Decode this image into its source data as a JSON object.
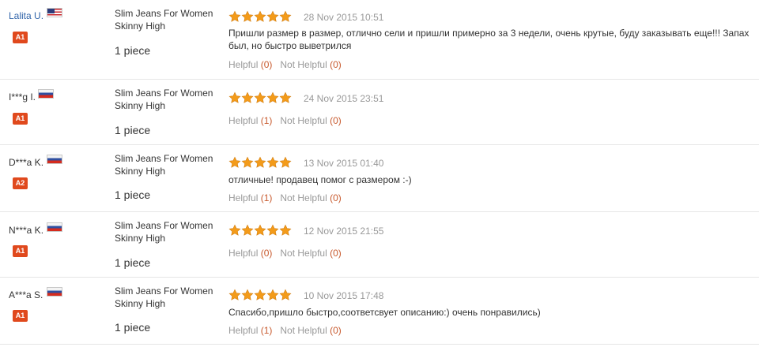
{
  "colors": {
    "level_badge": "#e0491d",
    "star": "#f39b1a",
    "count": "#c85a2e",
    "muted": "#999999",
    "link": "#3366aa"
  },
  "labels": {
    "helpful": "Helpful",
    "not_helpful": "Not Helpful"
  },
  "reviews": [
    {
      "buyer": "Lalita U.",
      "country_flag": "us-flag-icon",
      "level": "A1",
      "product": "Slim Jeans For Women Skinny High",
      "quantity": "1 piece",
      "rating": 5,
      "date": "28 Nov 2015 10:51",
      "text": "Пришли размер в размер, отлично сели и пришли примерно за 3 недели, очень крутые, буду заказывать еще!!! Запах был, но быстро выветрился",
      "helpful": "(0)",
      "not_helpful": "(0)"
    },
    {
      "buyer": "I***g I.",
      "country_flag": "ru-flag-icon",
      "level": "A1",
      "product": "Slim Jeans For Women Skinny High",
      "quantity": "1 piece",
      "rating": 5,
      "date": "24 Nov 2015 23:51",
      "text": "",
      "helpful": "(1)",
      "not_helpful": "(0)"
    },
    {
      "buyer": "D***a K.",
      "country_flag": "ru-flag-icon",
      "level": "A2",
      "product": "Slim Jeans For Women Skinny High",
      "quantity": "1 piece",
      "rating": 5,
      "date": "13 Nov 2015 01:40",
      "text": "отличные! продавец помог с размером :-)",
      "helpful": "(1)",
      "not_helpful": "(0)"
    },
    {
      "buyer": "N***a K.",
      "country_flag": "ru-flag-icon",
      "level": "A1",
      "product": "Slim Jeans For Women Skinny High",
      "quantity": "1 piece",
      "rating": 5,
      "date": "12 Nov 2015 21:55",
      "text": "",
      "helpful": "(0)",
      "not_helpful": "(0)"
    },
    {
      "buyer": "A***a S.",
      "country_flag": "ru-flag-icon",
      "level": "A1",
      "product": "Slim Jeans For Women Skinny High",
      "quantity": "1 piece",
      "rating": 5,
      "date": "10 Nov 2015 17:48",
      "text": "Спасибо,пришло быстро,соответсвует описанию:) очень понравились)",
      "helpful": "(1)",
      "not_helpful": "(0)"
    }
  ]
}
